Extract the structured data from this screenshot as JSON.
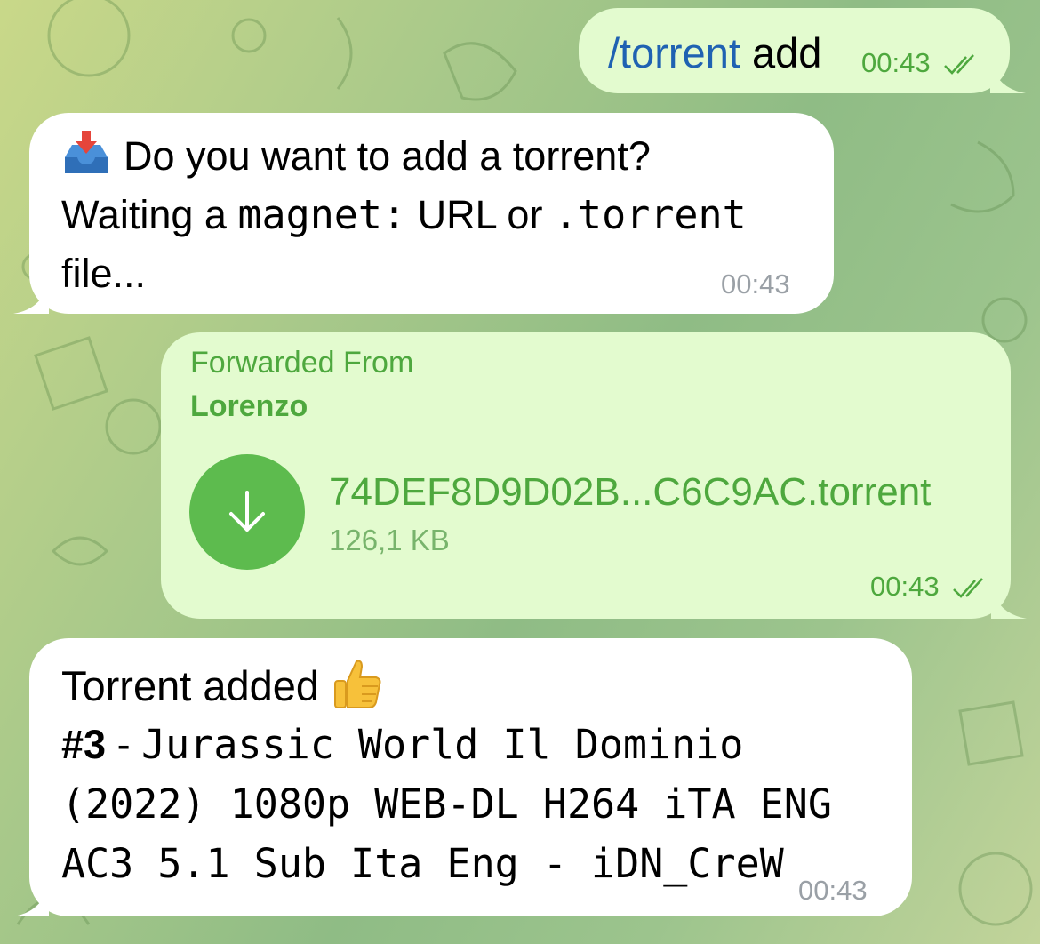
{
  "chat": {
    "messages": [
      {
        "id": "cmd",
        "direction": "outgoing",
        "command": "/torrent",
        "argument": " add",
        "time": "00:43",
        "status": "read"
      },
      {
        "id": "prompt",
        "direction": "incoming",
        "icon": "inbox-tray-icon",
        "line1": "Do you want to add a torrent?",
        "line2_prefix": "Waiting a ",
        "line2_code1": "magnet:",
        "line2_mid": " URL or ",
        "line2_code2": ".torrent",
        "line3": "file...",
        "time": "00:43"
      },
      {
        "id": "file",
        "direction": "outgoing",
        "forwarded_label": "Forwarded From",
        "forwarded_name": "Lorenzo",
        "file_name": "74DEF8D9D02B...C6C9AC.torrent",
        "file_size": "126,1 KB",
        "icon": "download-arrow-icon",
        "time": "00:43",
        "status": "read"
      },
      {
        "id": "result",
        "direction": "incoming",
        "title": "Torrent added",
        "icon": "thumbs-up-icon",
        "number": "#3",
        "separator": " - ",
        "mono_line1": "Jurassic World Il Dominio",
        "mono_line2": "(2022) 1080p WEB-DL H264 iTA ENG",
        "mono_line3": "AC3 5.1 Sub Ita Eng - iDN_CreW",
        "time": "00:43"
      }
    ]
  },
  "colors": {
    "outgoing_bubble": "#e3fbcf",
    "incoming_bubble": "#ffffff",
    "accent_green": "#4ea83e",
    "command_blue": "#1f62b2"
  }
}
